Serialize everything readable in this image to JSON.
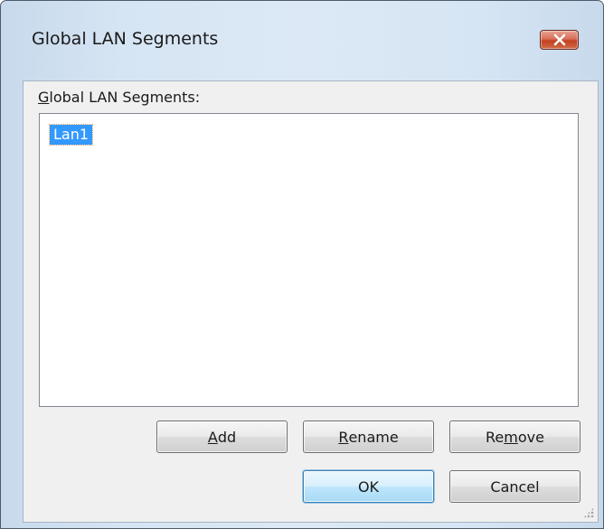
{
  "dialog": {
    "title": "Global LAN Segments",
    "close_icon": "close-icon"
  },
  "list": {
    "label_accel": "G",
    "label_rest": "lobal LAN Segments:",
    "items": [
      "Lan1"
    ],
    "selected_index": 0
  },
  "buttons": {
    "add": {
      "accel": "A",
      "rest": "dd"
    },
    "rename": {
      "accel": "R",
      "rest": "ename"
    },
    "remove_pre": "Re",
    "remove_accel": "m",
    "remove_post": "ove",
    "ok": "OK",
    "cancel": "Cancel"
  },
  "colors": {
    "selection": "#3399ff",
    "close_button": "#c2411f",
    "frame": "#dce8f5"
  }
}
